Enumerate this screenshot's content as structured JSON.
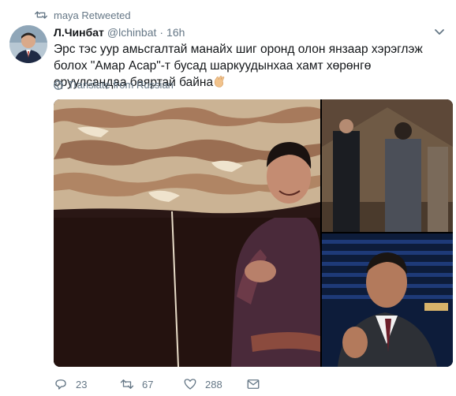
{
  "retweet": {
    "icon": "retweet-icon",
    "label": "maya Retweeted"
  },
  "tweet": {
    "author_name": "Л.Чинбат",
    "handle": "@lchinbat",
    "separator": "·",
    "time": "16h",
    "text": "Эрс тэс уур амьсгалтай манайх шиг оронд олон янзаар хэрэглэж болох \"Амар Асар\"-т бусад шаркуудынхаа хамт хөрөнгө оруулсандаа баяртай байна",
    "emoji_icon": "clapping-hands-icon",
    "translate_label": "Translate from Russian"
  },
  "actions": {
    "reply_count": "23",
    "retweet_count": "67",
    "like_count": "288"
  },
  "colors": {
    "secondary_text": "#657786",
    "primary_text": "#14171a"
  }
}
